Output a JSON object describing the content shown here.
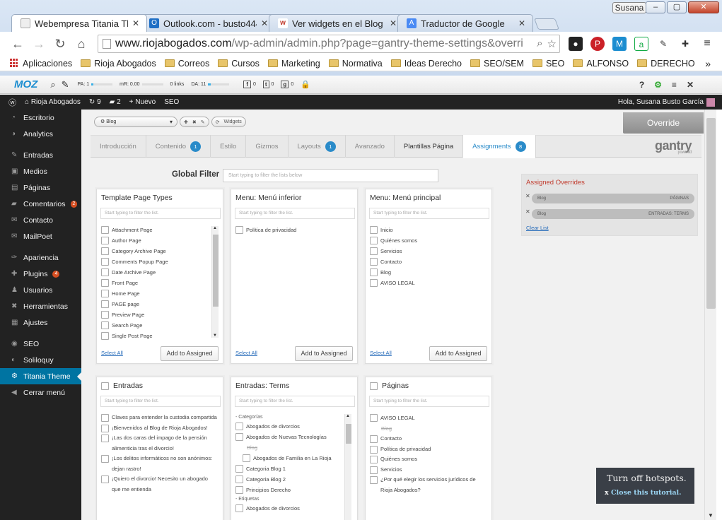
{
  "window": {
    "user": "Susana",
    "buttons": [
      "–",
      "▢",
      "✕"
    ]
  },
  "tabs": [
    {
      "label": "Webempresa Titania Ther",
      "active": true,
      "favicon": "page-icon",
      "color": "#ffffff"
    },
    {
      "label": "Outlook.com - busto444@",
      "active": false,
      "favicon": "outlook-icon",
      "color": "#1f6fc5"
    },
    {
      "label": "Ver widgets en el Blog pla",
      "active": false,
      "favicon": "blog-icon",
      "color": "#c0392b"
    },
    {
      "label": "Traductor de Google",
      "active": false,
      "favicon": "translate-icon",
      "color": "#4a8af4"
    }
  ],
  "address": {
    "domain": "www.riojabogados.com",
    "path": "/wp-admin/admin.php?page=gantry-theme-settings&overri"
  },
  "bookmarks": [
    {
      "label": "Aplicaciones",
      "type": "apps"
    },
    {
      "label": "Rioja Abogados",
      "type": "folder"
    },
    {
      "label": "Correos",
      "type": "folder"
    },
    {
      "label": "Cursos",
      "type": "folder"
    },
    {
      "label": "Marketing",
      "type": "folder"
    },
    {
      "label": "Normativa",
      "type": "folder"
    },
    {
      "label": "Ideas Derecho",
      "type": "folder"
    },
    {
      "label": "SEO/SEM",
      "type": "folder"
    },
    {
      "label": "SEO",
      "type": "folder"
    },
    {
      "label": "ALFONSO",
      "type": "folder"
    },
    {
      "label": "DERECHO",
      "type": "folder"
    }
  ],
  "bookmarks_more": "»",
  "moz": {
    "logo": "MOZ",
    "pa": "PA: 1",
    "mr": "mR: 0.00",
    "links": "0 links",
    "da": "DA: 11",
    "fb": "0",
    "tw": "0",
    "gp": "0",
    "right": [
      "?",
      "⚙",
      "≡",
      "✕"
    ]
  },
  "wpbar": {
    "site": "Rioja Abogados",
    "updates": "9",
    "comments": "2",
    "new": "Nuevo",
    "seo": "SEO",
    "greeting": "Hola, Susana Busto García"
  },
  "sidebar": [
    {
      "label": "Escritorio",
      "icon": "dashboard-icon"
    },
    {
      "label": "Analytics",
      "icon": "analytics-icon"
    },
    {
      "gap": true
    },
    {
      "label": "Entradas",
      "icon": "pin-icon"
    },
    {
      "label": "Medios",
      "icon": "media-icon"
    },
    {
      "label": "Páginas",
      "icon": "pages-icon"
    },
    {
      "label": "Comentarios",
      "icon": "comments-icon",
      "badge": "2"
    },
    {
      "label": "Contacto",
      "icon": "mail-icon"
    },
    {
      "label": "MailPoet",
      "icon": "mailpoet-icon"
    },
    {
      "gap": true
    },
    {
      "label": "Apariencia",
      "icon": "brush-icon"
    },
    {
      "label": "Plugins",
      "icon": "plugin-icon",
      "badge": "4"
    },
    {
      "label": "Usuarios",
      "icon": "users-icon"
    },
    {
      "label": "Herramientas",
      "icon": "wrench-icon"
    },
    {
      "label": "Ajustes",
      "icon": "settings-icon"
    },
    {
      "gap": true
    },
    {
      "label": "SEO",
      "icon": "seo-icon"
    },
    {
      "label": "Soliloquy",
      "icon": "soliloquy-icon"
    },
    {
      "label": "Titania Theme",
      "icon": "gear-icon",
      "active": true
    },
    {
      "label": "Cerrar menú",
      "icon": "collapse-icon"
    }
  ],
  "gantry": {
    "override_select": "Blog",
    "widgets": "Widgets",
    "override_btn": "Override",
    "logo": "gantry",
    "logo_sub": "powered",
    "tabs": [
      {
        "label": "Introducción"
      },
      {
        "label": "Contenido",
        "badge": "1"
      },
      {
        "label": "Estilo"
      },
      {
        "label": "Gizmos"
      },
      {
        "label": "Layouts",
        "badge": "1"
      },
      {
        "label": "Avanzado"
      },
      {
        "label": "Plantillas Página",
        "dark": true
      },
      {
        "label": "Assignments",
        "badge": "8",
        "active": true
      }
    ],
    "global_filter": "Global Filter",
    "global_placeholder": "Start typing to filter the lists below",
    "filter_placeholder": "Start typing to filter the list.",
    "select_all": "Select All",
    "add_btn": "Add to Assigned",
    "panels": {
      "tpt": {
        "title": "Template Page Types",
        "items": [
          "Attachment Page",
          "Author Page",
          "Category Archive Page",
          "Comments Popup Page",
          "Date Archive Page",
          "Front Page",
          "Home Page",
          "PAGE page",
          "Preview Page",
          "Search Page",
          "Single Post Page"
        ]
      },
      "inferior": {
        "title": "Menu: Menú inferior",
        "items": [
          "Política de privacidad"
        ]
      },
      "principal": {
        "title": "Menu: Menú principal",
        "items": [
          "Inicio",
          "Quiénes somos",
          "Servicios",
          "Contacto",
          "Blog",
          "AVISO LEGAL"
        ]
      },
      "entradas": {
        "title": "Entradas",
        "items": [
          "Claves para entender la custodia compartida",
          "¡Bienvenidos al Blog de Rioja Abogados!",
          "¡Las dos caras del impago de la pensión alimenticia tras el divorcio!",
          "¡Los delitos informáticos no son anónimos: dejan rastro!",
          "¡Quiero el divorcio! Necesito un abogado que me entienda"
        ]
      },
      "terms": {
        "title": "Entradas: Terms",
        "cat_label": "- Categorías",
        "items": [
          "Abogados de divorcios",
          "Abogados de Nuevas Tecnologías"
        ],
        "struck": "Blog",
        "sub": "Abogados de Familia en La Rioja",
        "items2": [
          "Categoria Blog 1",
          "Categoria Blog 2",
          "Principios Derecho"
        ],
        "etq_label": "- Etiquetas",
        "items3": [
          "Abogados de divorcios"
        ]
      },
      "paginas": {
        "title": "Páginas",
        "first": "AVISO LEGAL",
        "struck": "Blog",
        "items": [
          "Contacto",
          "Política de privacidad",
          "Quiénes somos",
          "Servicios",
          "¿Por qué elegir los servicios jurídicos de Rioja Abogados?"
        ]
      }
    },
    "assigned": {
      "title": "Assigned Overrides",
      "rows": [
        {
          "name": "Blog",
          "type": "PÁGINAS"
        },
        {
          "name": "Blog",
          "type": "ENTRADAS: TERMS"
        }
      ],
      "clear": "Clear List"
    }
  },
  "tutorial": {
    "line1": "Turn off hotspots.",
    "line2": "Close this tutorial."
  }
}
